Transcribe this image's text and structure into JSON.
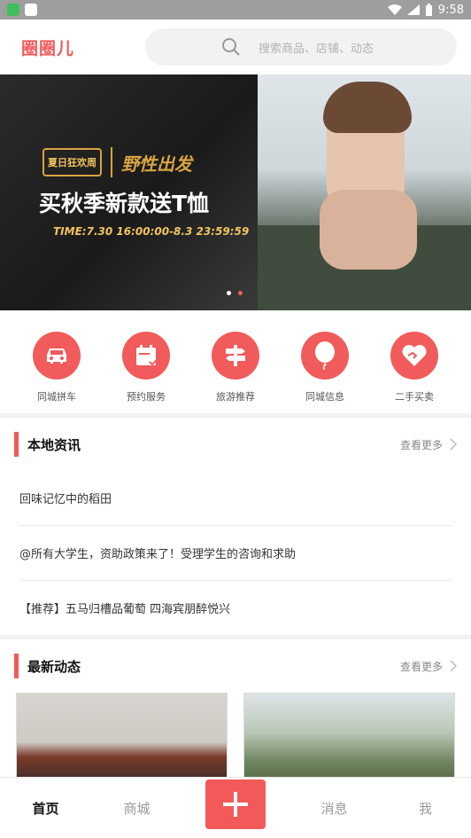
{
  "status_bar": {
    "time": "9:58"
  },
  "app": {
    "logo_text": "圈圈儿"
  },
  "search": {
    "placeholder": "搜索商品、店铺、动态"
  },
  "banner": {
    "tmall_badge": "夏日狂欢周",
    "slogan": "野性出发",
    "title": "买秋季新款送T恤",
    "time": "TIME:7.30 16:00:00-8.3 23:59:59"
  },
  "quick_links": [
    {
      "label": "同城拼车",
      "icon": "car-icon"
    },
    {
      "label": "预约服务",
      "icon": "calendar-icon"
    },
    {
      "label": "旅游推荐",
      "icon": "signpost-icon"
    },
    {
      "label": "同城信息",
      "icon": "balloon-icon"
    },
    {
      "label": "二手买卖",
      "icon": "handshake-icon"
    }
  ],
  "local_news": {
    "title": "本地资讯",
    "more": "查看更多",
    "items": [
      "回味记忆中的稻田",
      "@所有大学生，资助政策来了！受理学生的咨询和求助",
      "【推荐】五马归槽品葡萄 四海宾朋醉悦兴"
    ]
  },
  "latest": {
    "title": "最新动态",
    "more": "查看更多"
  },
  "bottom_nav": {
    "home": "首页",
    "mall": "商城",
    "messages": "消息",
    "me": "我"
  },
  "colors": {
    "accent": "#f25a5a",
    "status_bar": "#9e9e9e"
  }
}
